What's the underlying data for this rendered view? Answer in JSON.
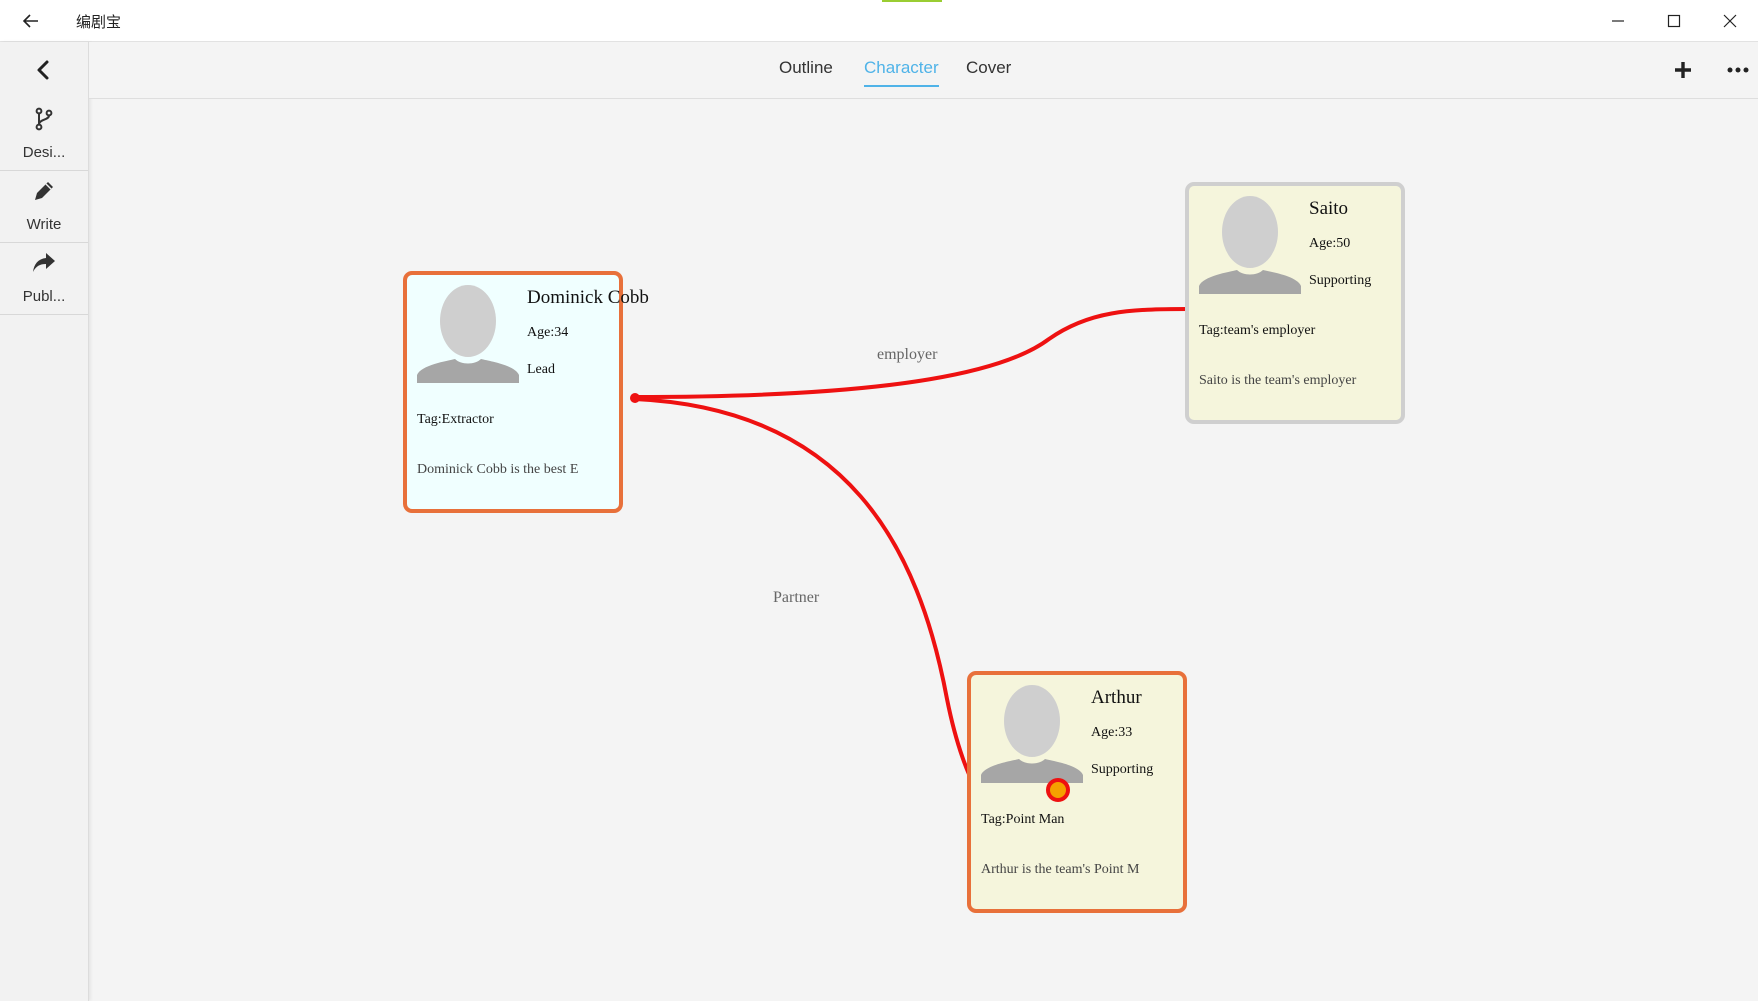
{
  "app": {
    "title": "编剧宝"
  },
  "sidebar": {
    "items": [
      {
        "label": "Desi...",
        "icon": "branch-icon"
      },
      {
        "label": "Write",
        "icon": "pencil-icon"
      },
      {
        "label": "Publ...",
        "icon": "share-icon"
      }
    ]
  },
  "header": {
    "tabs": [
      {
        "label": "Outline",
        "active": false
      },
      {
        "label": "Character",
        "active": true
      },
      {
        "label": "Cover",
        "active": false
      }
    ]
  },
  "characters": [
    {
      "name": "Dominick Cobb",
      "age": "Age:34",
      "role": "Lead",
      "tag": "Tag:Extractor",
      "desc": "Dominick Cobb is the best E",
      "border_color": "#e8703a",
      "bg_color": "#f0ffff"
    },
    {
      "name": "Saito",
      "age": "Age:50",
      "role": "Supporting",
      "tag": "Tag:team's employer",
      "desc": "Saito is the team's employer",
      "border_color": "#cfcfcf",
      "bg_color": "#f5f5dc"
    },
    {
      "name": "Arthur",
      "age": "Age:33",
      "role": "Supporting",
      "tag": "Tag:Point Man",
      "desc": "Arthur is the team's Point M",
      "border_color": "#e8703a",
      "bg_color": "#f5f5dc"
    }
  ],
  "relations": [
    {
      "from": "Dominick Cobb",
      "to": "Saito",
      "label": "employer"
    },
    {
      "from": "Dominick Cobb",
      "to": "Arthur",
      "label": "Partner"
    }
  ],
  "colors": {
    "accent": "#4fb3e8",
    "edge": "#ee1111",
    "handle": "#f5a000"
  }
}
